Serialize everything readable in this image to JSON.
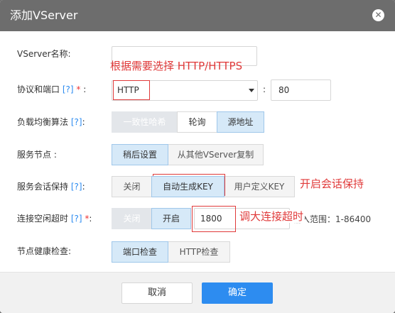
{
  "dialog": {
    "title": "添加VServer",
    "close_glyph": "✕"
  },
  "form": {
    "name": {
      "label": "VServer名称:",
      "value": ""
    },
    "protocol": {
      "label": "协议和端口",
      "help": "[?]",
      "required": "*",
      "suffix": ":",
      "value": "HTTP",
      "port_colon": ":",
      "port": "80"
    },
    "balance": {
      "label": "负载均衡算法",
      "help": "[?]",
      "suffix": ":",
      "options": [
        "一致性哈希",
        "轮询",
        "源地址"
      ]
    },
    "nodes": {
      "label": "服务节点 :",
      "options": [
        "稍后设置",
        "从其他VServer复制"
      ]
    },
    "session": {
      "label": "服务会话保持",
      "help": "[?]",
      "suffix": ":",
      "options": [
        "关闭",
        "自动生成KEY",
        "用户定义KEY"
      ]
    },
    "idle": {
      "label": "连接空闲超时",
      "help": "[?]",
      "required": "*",
      "suffix": ":",
      "options": [
        "关闭",
        "开启"
      ],
      "value": "1800",
      "range": "输入范围：1-86400"
    },
    "health": {
      "label": "节点健康检查:",
      "options": [
        "端口检查",
        "HTTP检查"
      ]
    }
  },
  "annotations": {
    "protocol_note": "根据需要选择 HTTP/HTTPS",
    "session_note": "开启会话保持",
    "timeout_note": "调大连接超时"
  },
  "footer": {
    "cancel": "取消",
    "ok": "确定"
  },
  "colors": {
    "accent": "#2d8cf0",
    "annotation": "#e03a3a",
    "header": "#6d6d6d"
  },
  "icons": {
    "close": "close-icon",
    "dropdown": "caret-down-icon"
  }
}
